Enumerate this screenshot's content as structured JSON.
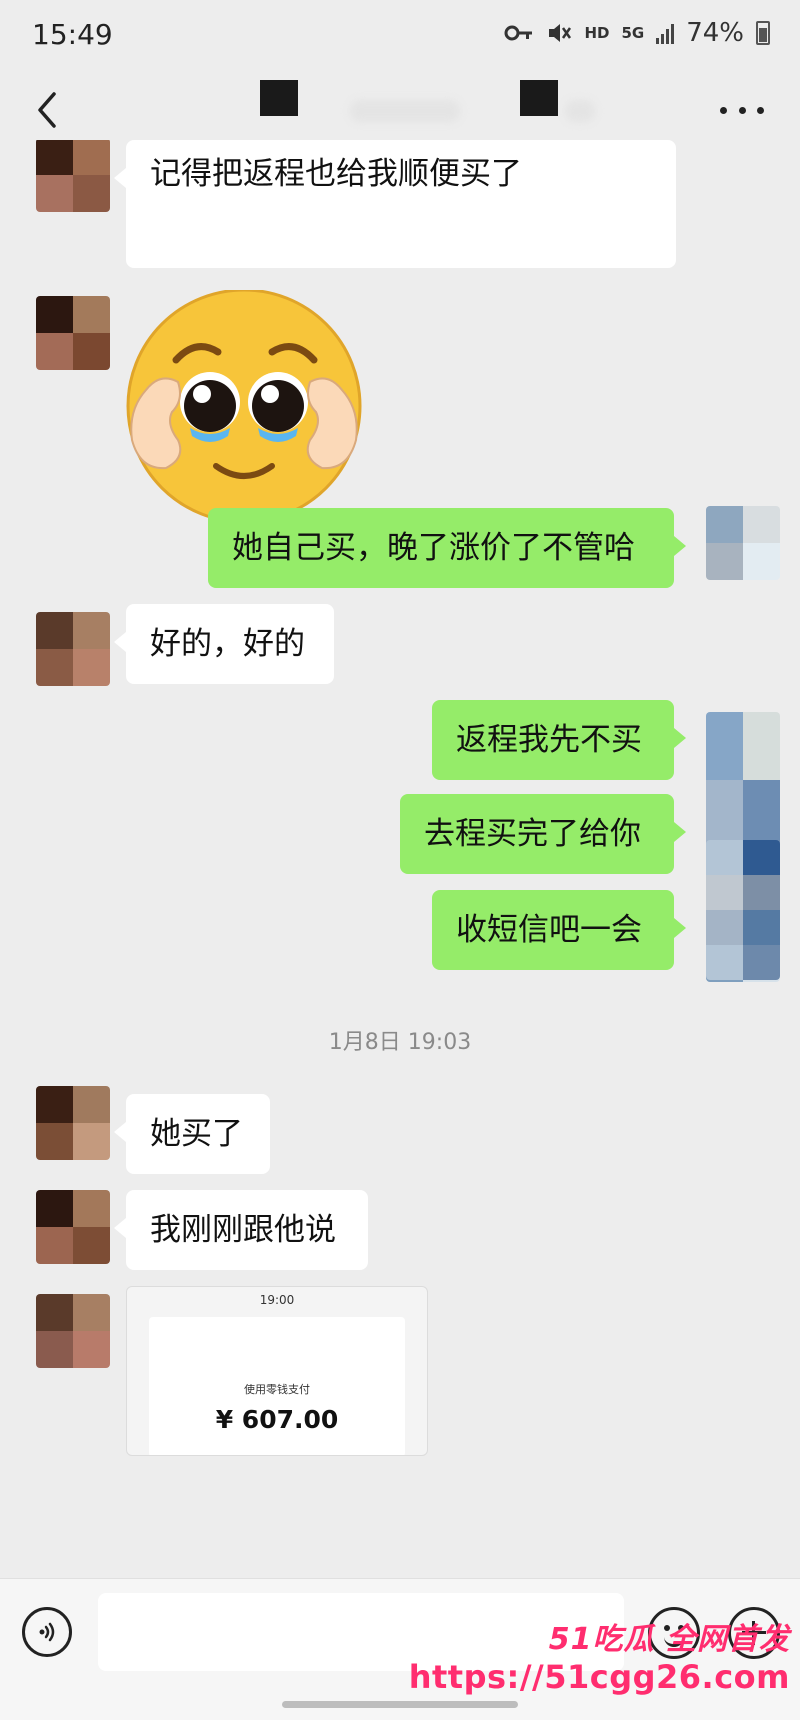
{
  "status_bar": {
    "time": "15:49",
    "network_hd": "HD",
    "network_5g": "5G",
    "battery": "74%",
    "icons": [
      "key-icon",
      "mute-icon",
      "signal-icon",
      "battery-icon"
    ]
  },
  "nav": {
    "back_icon": "chevron-left-icon",
    "title": "",
    "more_icon": "more-dots-icon"
  },
  "colors": {
    "chat_background": "#ededed",
    "incoming_bubble": "#ffffff",
    "outgoing_bubble": "#95ec69",
    "watermark": "#ff2d6f"
  },
  "messages": [
    {
      "side": "in",
      "type": "text",
      "text": "记得把返程也给我顺便买了"
    },
    {
      "side": "in",
      "type": "sticker",
      "sticker": "pleading-face-heart-hands-emoji"
    },
    {
      "side": "out",
      "type": "text",
      "text": "她自己买，晚了涨价了不管哈"
    },
    {
      "side": "in",
      "type": "text",
      "text": "好的，好的"
    },
    {
      "side": "out",
      "type": "text",
      "text": "返程我先不买"
    },
    {
      "side": "out",
      "type": "text",
      "text": "去程买完了给你"
    },
    {
      "side": "out",
      "type": "text",
      "text": "收短信吧一会"
    },
    {
      "side": "system",
      "type": "timestamp",
      "text": "1月8日 19:03"
    },
    {
      "side": "in",
      "type": "text",
      "text": "她买了"
    },
    {
      "side": "in",
      "type": "text",
      "text": "我刚刚跟他说"
    },
    {
      "side": "in",
      "type": "image",
      "screenshot_time": "19:00",
      "payment_label": "使用零钱支付",
      "amount": "¥ 607.00"
    }
  ],
  "input_bar": {
    "voice_icon": "voice-icon",
    "text_value": "",
    "emoji_icon": "emoji-icon",
    "plus_icon": "plus-icon"
  },
  "watermark": {
    "top_line": "51吃瓜 全网首发",
    "url": "https://51cgg26.com"
  }
}
